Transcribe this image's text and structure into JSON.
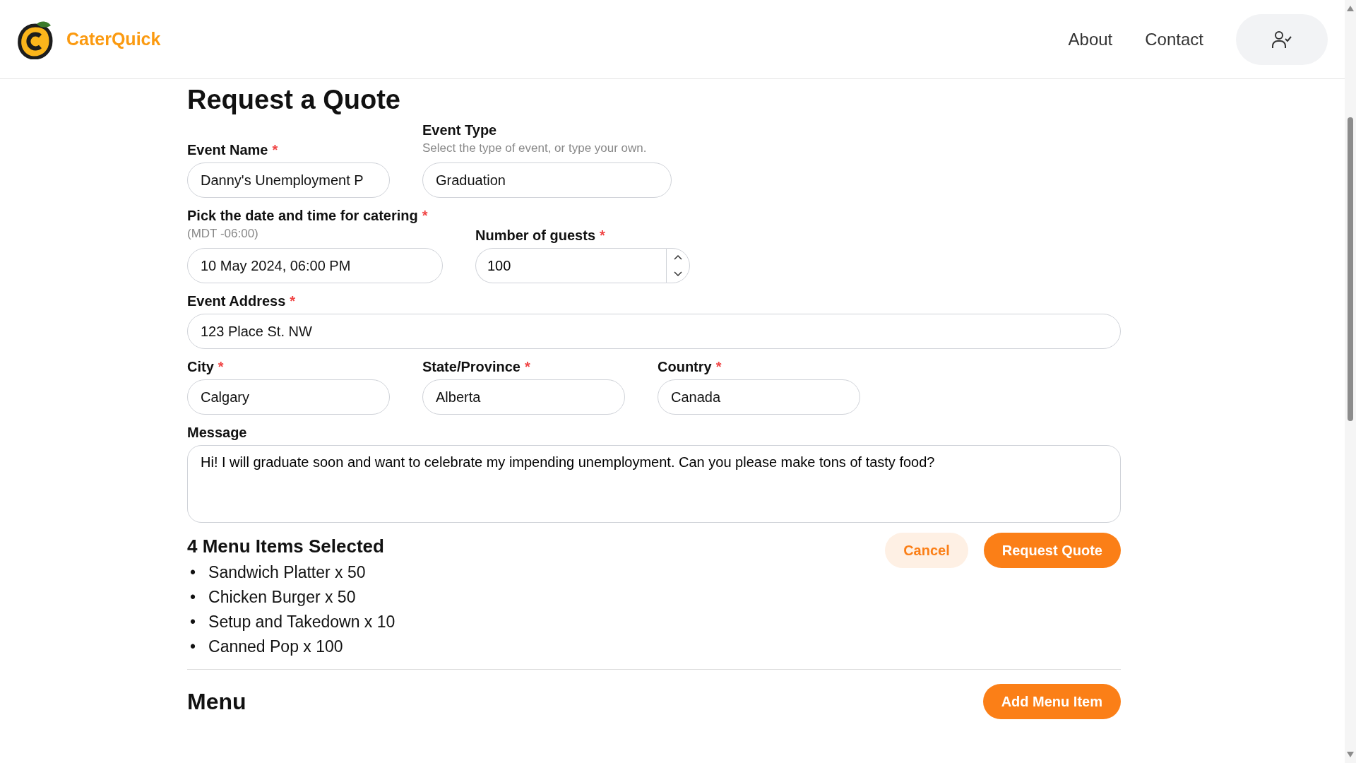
{
  "header": {
    "brand": "CaterQuick",
    "nav": [
      "About",
      "Contact"
    ]
  },
  "form": {
    "title": "Request a Quote",
    "rows": [
      [
        {
          "kind": "text",
          "label": "Event Name",
          "required_mark": "*",
          "value": "Danny's Unemployment P"
        },
        {
          "kind": "text",
          "label": "Event Type",
          "hint": "Select the type of event, or type your own.",
          "value": "Graduation"
        }
      ],
      [
        {
          "kind": "text",
          "label": "Pick the date and time for catering",
          "required_mark": "*",
          "note": "(MDT -06:00)",
          "value": "10 May 2024, 06:00 PM"
        },
        {
          "kind": "number",
          "label": "Number of guests",
          "required_mark": "*",
          "value": "100"
        }
      ],
      [
        {
          "kind": "text",
          "label": "Event Address",
          "required_mark": "*",
          "value": "123 Place St. NW"
        }
      ],
      [
        {
          "kind": "text",
          "label": "City",
          "required_mark": "*",
          "value": "Calgary"
        },
        {
          "kind": "text",
          "label": "State/Province",
          "required_mark": "*",
          "value": "Alberta"
        },
        {
          "kind": "text",
          "label": "Country",
          "required_mark": "*",
          "value": "Canada"
        }
      ],
      [
        {
          "kind": "textarea",
          "label": "Message",
          "value": "Hi! I will graduate soon and want to celebrate my impending unemployment. Can you please make tons of tasty food?"
        }
      ]
    ]
  },
  "selection": {
    "title": "4 Menu Items Selected",
    "items": [
      {
        "bullet": "•",
        "text": "Sandwich Platter x 50"
      },
      {
        "bullet": "•",
        "text": "Chicken Burger x 50"
      },
      {
        "bullet": "•",
        "text": "Setup and Takedown x 10"
      },
      {
        "bullet": "•",
        "text": "Canned Pop x 100"
      }
    ],
    "cancel": "Cancel",
    "submit": "Request Quote"
  },
  "menu": {
    "title": "Menu",
    "add_button": "Add Menu Item"
  }
}
